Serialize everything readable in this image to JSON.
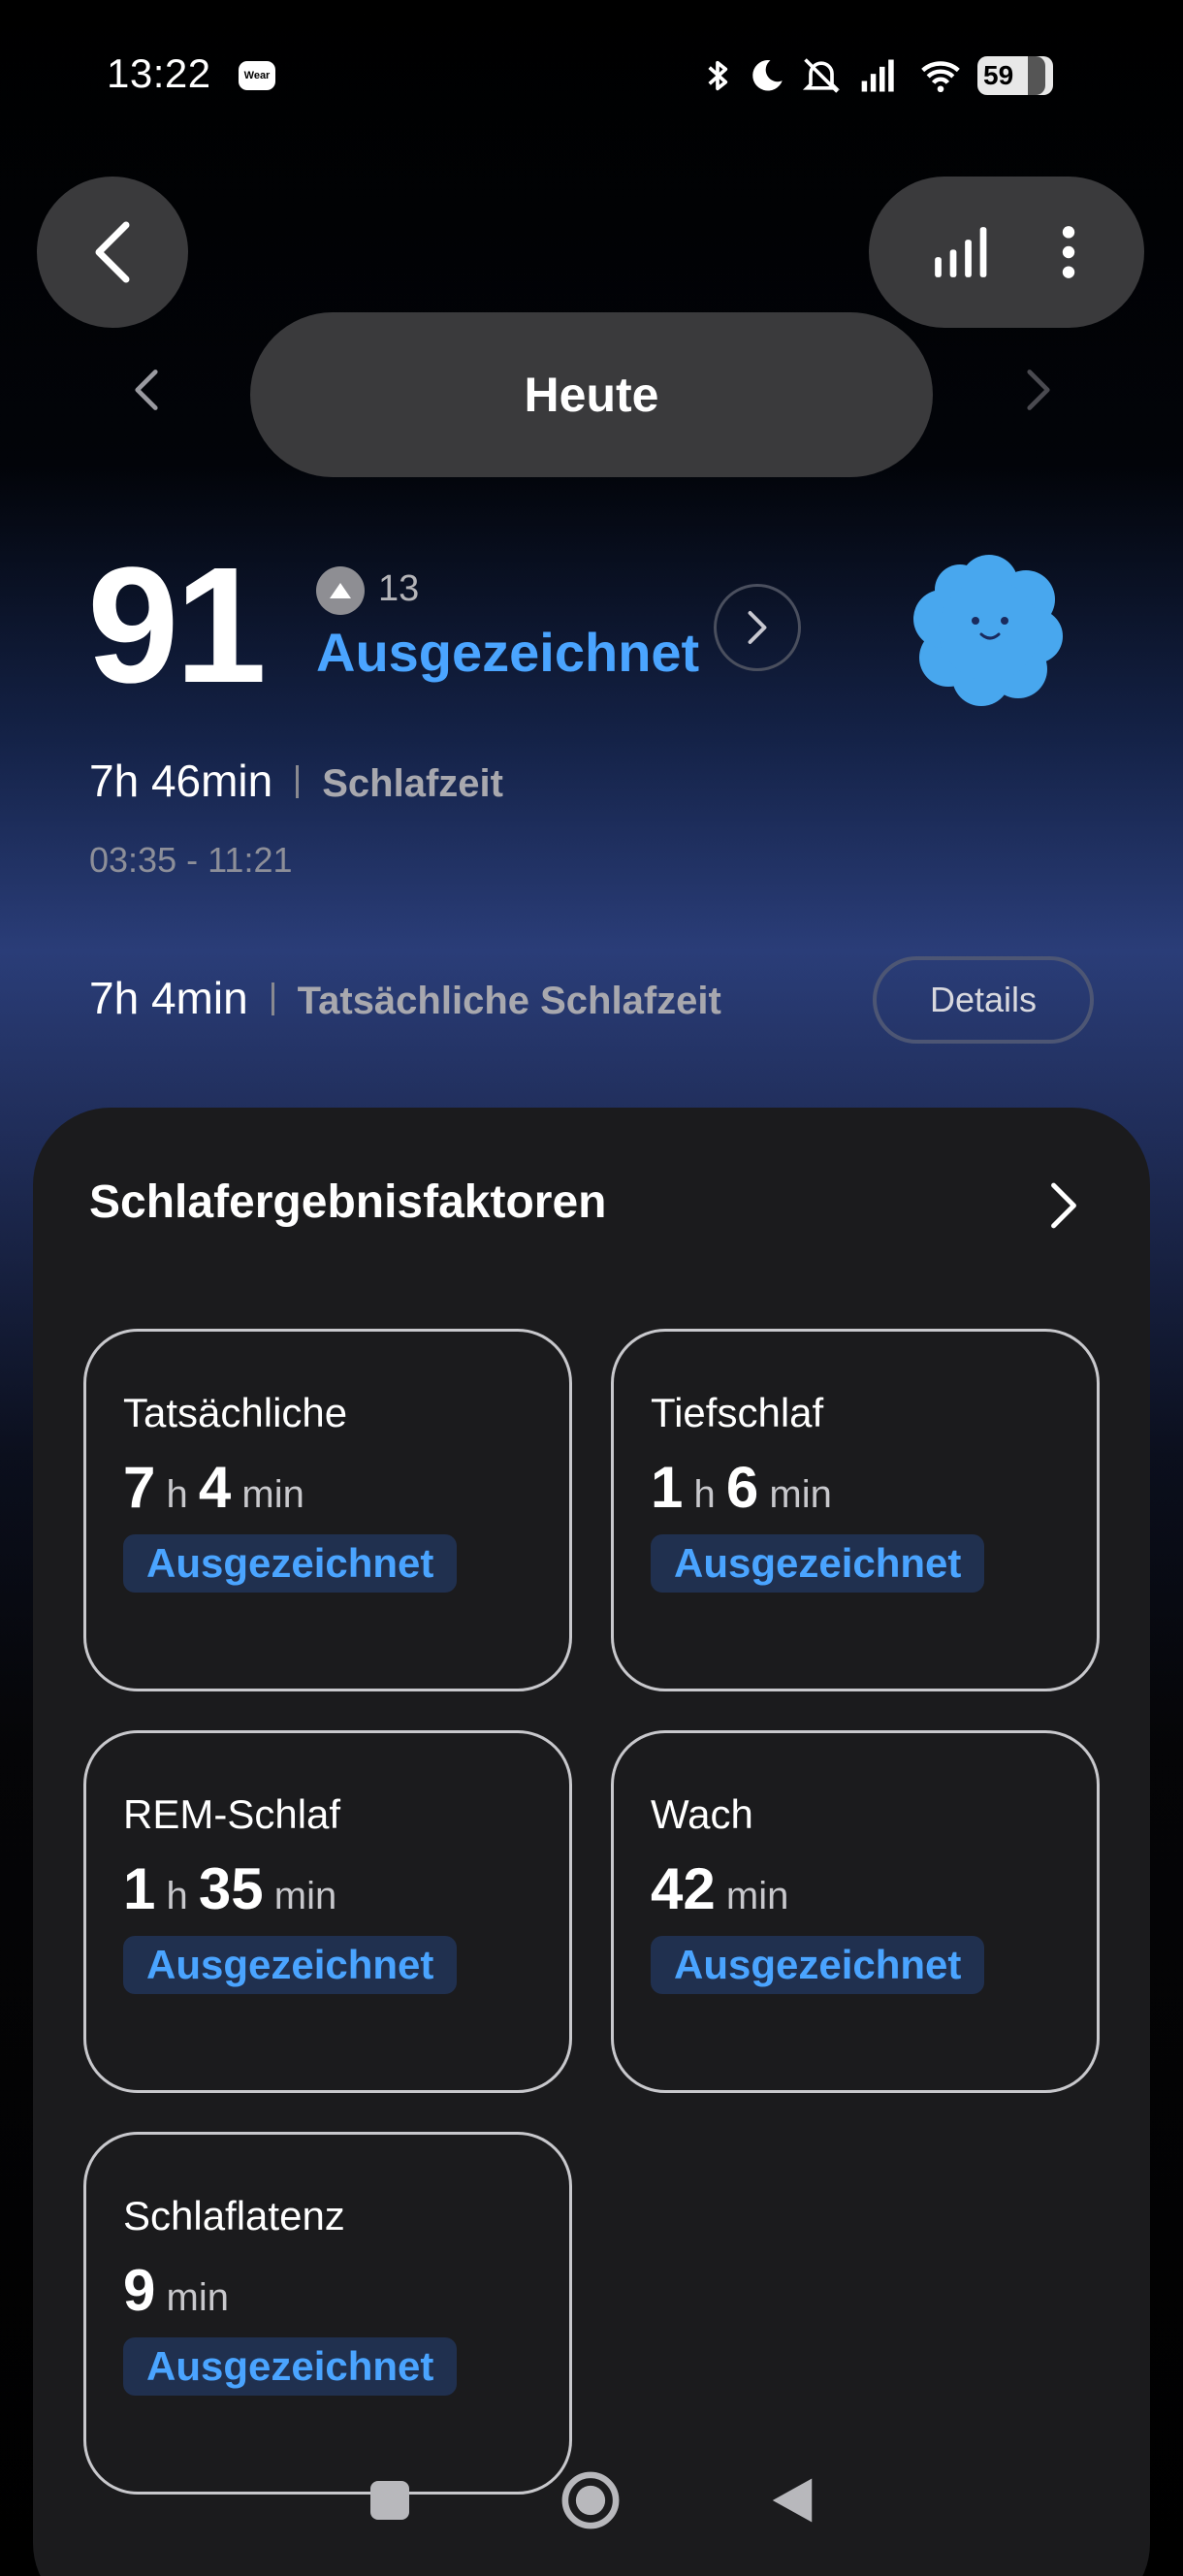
{
  "status_bar": {
    "time": "13:22",
    "wear_badge": "Wear",
    "battery": "59"
  },
  "header": {
    "date_label": "Heute"
  },
  "score": {
    "value": "91",
    "delta": "13",
    "rating": "Ausgezeichnet"
  },
  "sleep": {
    "duration": "7h 46min",
    "duration_label": "Schlafzeit",
    "range": "03:35 - 11:21",
    "actual": "7h 4min",
    "actual_label": "Tatsächliche Schlafzeit",
    "details_label": "Details"
  },
  "factors": {
    "title": "Schlafergebnisfaktoren",
    "items": [
      {
        "title": "Tatsächliche",
        "v1": "7",
        "u1": "h",
        "v2": "4",
        "u2": "min",
        "badge": "Ausgezeichnet"
      },
      {
        "title": "Tiefschlaf",
        "v1": "1",
        "u1": "h",
        "v2": "6",
        "u2": "min",
        "badge": "Ausgezeichnet"
      },
      {
        "title": "REM-Schlaf",
        "v1": "1",
        "u1": "h",
        "v2": "35",
        "u2": "min",
        "badge": "Ausgezeichnet"
      },
      {
        "title": "Wach",
        "v1": "42",
        "u1": "min",
        "badge": "Ausgezeichnet"
      },
      {
        "title": "Schlaflatenz",
        "v1": "9",
        "u1": "min",
        "badge": "Ausgezeichnet"
      }
    ]
  },
  "colors": {
    "accent": "#4aa4ff",
    "badge_bg": "#20304f",
    "card_bg": "#1b1b1d",
    "pill_bg": "#3a3a3c"
  },
  "icons": {
    "back": "chevron-left-icon",
    "chart": "bar-chart-icon",
    "menu": "more-vertical-icon",
    "prev": "chevron-left-icon",
    "next": "chevron-right-icon",
    "score_detail": "chevron-right-icon",
    "delta": "triangle-up-icon",
    "mascot": "cloud-mascot-icon"
  }
}
